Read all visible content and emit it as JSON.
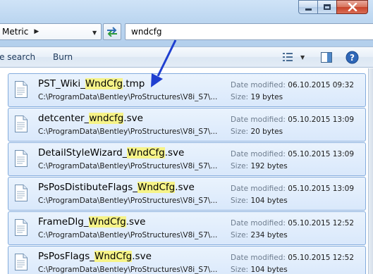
{
  "window": {
    "caption_buttons": [
      "minimize",
      "maximize",
      "close"
    ]
  },
  "address_bar": {
    "location": "Metric",
    "refresh_icon": "refresh-arrows-icon"
  },
  "search": {
    "value": "wndcfg"
  },
  "toolbar": {
    "save_search_label": "ve search",
    "burn_label": "Burn",
    "views_icon": "views-icon",
    "preview_icon": "preview-pane-icon",
    "help_icon": "help-icon"
  },
  "meta_labels": {
    "date": "Date modified:",
    "size": "Size:"
  },
  "results": [
    {
      "prefix": "PST_Wiki_",
      "match": "WndCfg",
      "suffix": ".tmp",
      "path": "C:\\ProgramData\\Bentley\\ProStructures\\V8i_S7\\...",
      "date": "06.10.2015 09:32",
      "size": "19 bytes"
    },
    {
      "prefix": "detcenter_",
      "match": "wndcfg",
      "suffix": ".sve",
      "path": "C:\\ProgramData\\Bentley\\ProStructures\\V8i_S7\\...",
      "date": "05.10.2015 13:09",
      "size": "20 bytes"
    },
    {
      "prefix": "DetailStyleWizard_",
      "match": "WndCfg",
      "suffix": ".sve",
      "path": "C:\\ProgramData\\Bentley\\ProStructures\\V8i_S7\\...",
      "date": "05.10.2015 13:09",
      "size": "192 bytes"
    },
    {
      "prefix": "PsPosDistibuteFlags_",
      "match": "WndCfg",
      "suffix": ".sve",
      "path": "C:\\ProgramData\\Bentley\\ProStructures\\V8i_S7\\...",
      "date": "05.10.2015 13:09",
      "size": "104 bytes"
    },
    {
      "prefix": "FrameDlg_",
      "match": "WndCfg",
      "suffix": ".sve",
      "path": "C:\\ProgramData\\Bentley\\ProStructures\\V8i_S7\\...",
      "date": "05.10.2015 12:52",
      "size": "234 bytes"
    },
    {
      "prefix": "PsPosFlags_",
      "match": "WndCfg",
      "suffix": ".sve",
      "path": "C:\\ProgramData\\Bentley\\ProStructures\\V8i_S7\\...",
      "date": "05.10.2015 12:52",
      "size": "104 bytes"
    }
  ],
  "colors": {
    "highlight": "#f6f388",
    "arrow": "#1f3fd0",
    "row_border": "#84acdd"
  }
}
